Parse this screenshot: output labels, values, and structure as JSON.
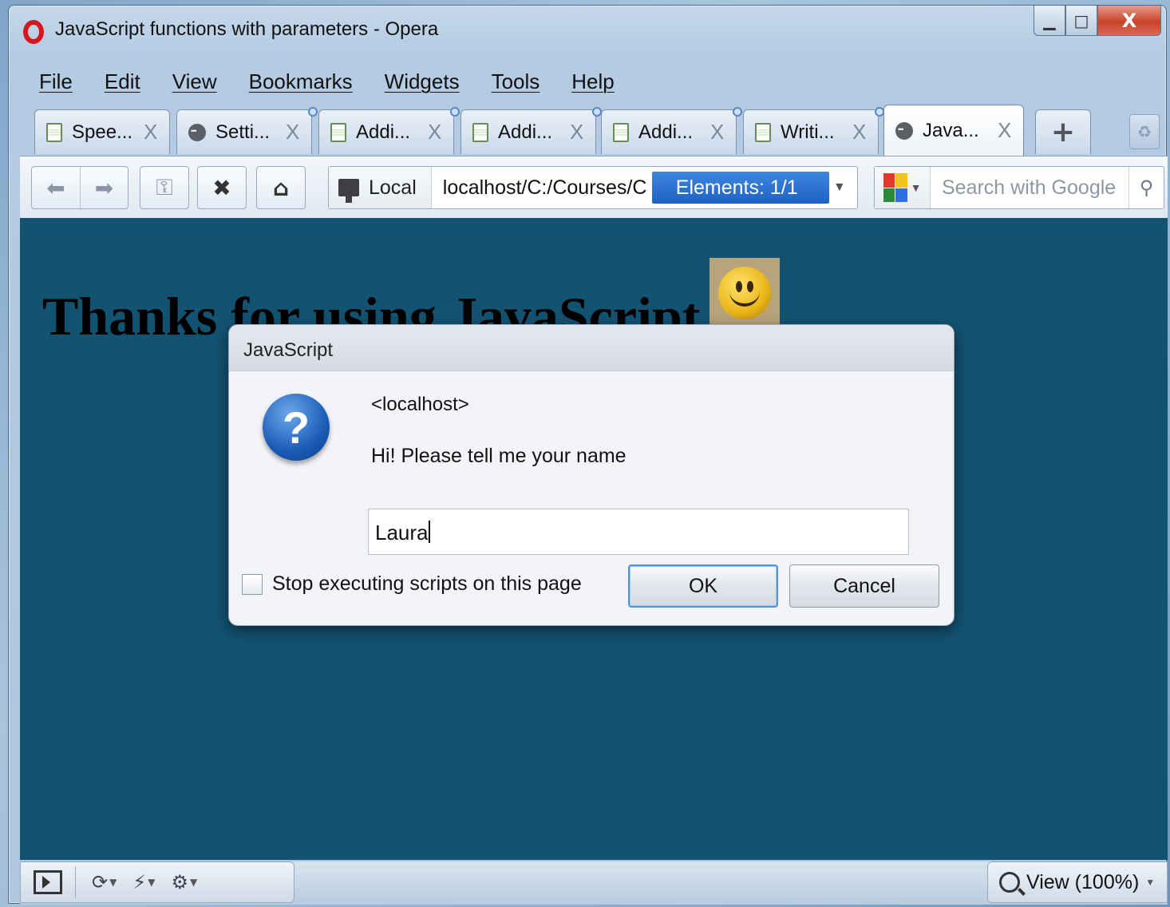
{
  "window": {
    "title": "JavaScript functions with parameters - Opera",
    "minimize_label": "▁",
    "maximize_label": "□",
    "close_label": "X"
  },
  "menu": [
    {
      "label": "File"
    },
    {
      "label": "Edit"
    },
    {
      "label": "View"
    },
    {
      "label": "Bookmarks"
    },
    {
      "label": "Widgets"
    },
    {
      "label": "Tools"
    },
    {
      "label": "Help"
    }
  ],
  "tabs": [
    {
      "label": "Spee...",
      "icon": "page-icon",
      "close": "X"
    },
    {
      "label": "Setti...",
      "icon": "opera-settings-icon",
      "close": "X"
    },
    {
      "label": "Addi...",
      "icon": "page-icon",
      "close": "X"
    },
    {
      "label": "Addi...",
      "icon": "page-icon",
      "close": "X"
    },
    {
      "label": "Addi...",
      "icon": "page-icon",
      "close": "X"
    },
    {
      "label": "Writi...",
      "icon": "page-icon",
      "close": "X"
    },
    {
      "label": "Java...",
      "icon": "opera-settings-icon",
      "close": "X",
      "active": true
    }
  ],
  "new_tab_label": "+",
  "address": {
    "local_label": "Local",
    "url": "localhost/C:/Courses/C:",
    "elements_label": "Elements:  1/1"
  },
  "search": {
    "placeholder": "Search with Google"
  },
  "page": {
    "heading": "Thanks for using JavaScript"
  },
  "dialog": {
    "title": "JavaScript",
    "origin": "<localhost>",
    "message": "Hi!  Please tell me your name",
    "input_value": "Laura",
    "checkbox_label": "Stop executing scripts on this page",
    "ok_label": "OK",
    "cancel_label": "Cancel"
  },
  "statusbar": {
    "zoom_label": "View (100%)"
  },
  "colors": {
    "page_background": "#135372",
    "elements_highlight": "#1f62c3",
    "opera_red": "#d6161f"
  }
}
